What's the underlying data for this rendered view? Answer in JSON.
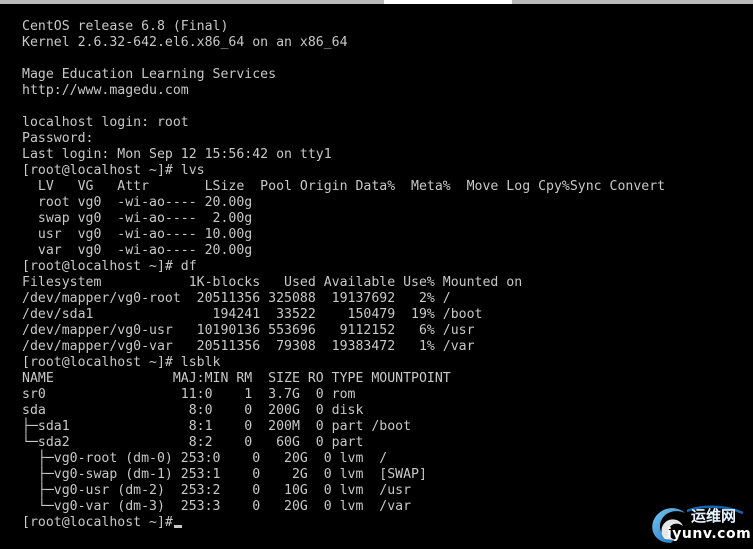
{
  "window": {
    "tab_accent": "#ffffff",
    "background": "#000000",
    "text_color": "#c8c8c8"
  },
  "terminal": {
    "lines": [
      "CentOS release 6.8 (Final)",
      "Kernel 2.6.32-642.el6.x86_64 on an x86_64",
      "",
      "Mage Education Learning Services",
      "http://www.magedu.com",
      "",
      "localhost login: root",
      "Password:",
      "Last login: Mon Sep 12 15:56:42 on tty1",
      "[root@localhost ~]# lvs",
      "  LV   VG   Attr       LSize  Pool Origin Data%  Meta%  Move Log Cpy%Sync Convert",
      "  root vg0  -wi-ao---- 20.00g",
      "  swap vg0  -wi-ao----  2.00g",
      "  usr  vg0  -wi-ao---- 10.00g",
      "  var  vg0  -wi-ao---- 20.00g",
      "[root@localhost ~]# df",
      "Filesystem           1K-blocks   Used Available Use% Mounted on",
      "/dev/mapper/vg0-root  20511356 325088  19137692   2% /",
      "/dev/sda1               194241  33522    150479  19% /boot",
      "/dev/mapper/vg0-usr   10190136 553696   9112152   6% /usr",
      "/dev/mapper/vg0-var   20511356  79308  19383472   1% /var",
      "[root@localhost ~]# lsblk",
      "NAME               MAJ:MIN RM  SIZE RO TYPE MOUNTPOINT",
      "sr0                 11:0    1  3.7G  0 rom",
      "sda                  8:0    0  200G  0 disk",
      "├─sda1               8:1    0  200M  0 part /boot",
      "└─sda2               8:2    0   60G  0 part",
      "  ├─vg0-root (dm-0) 253:0    0   20G  0 lvm  /",
      "  ├─vg0-swap (dm-1) 253:1    0    2G  0 lvm  [SWAP]",
      "  ├─vg0-usr (dm-2)  253:2    0   10G  0 lvm  /usr",
      "  └─vg0-var (dm-3)  253:3    0   20G  0 lvm  /var",
      "[root@localhost ~]#"
    ]
  },
  "watermark": {
    "chinese_text": "运维网",
    "site_text": "iyunv.com",
    "icon": "swirl-logo-icon"
  }
}
